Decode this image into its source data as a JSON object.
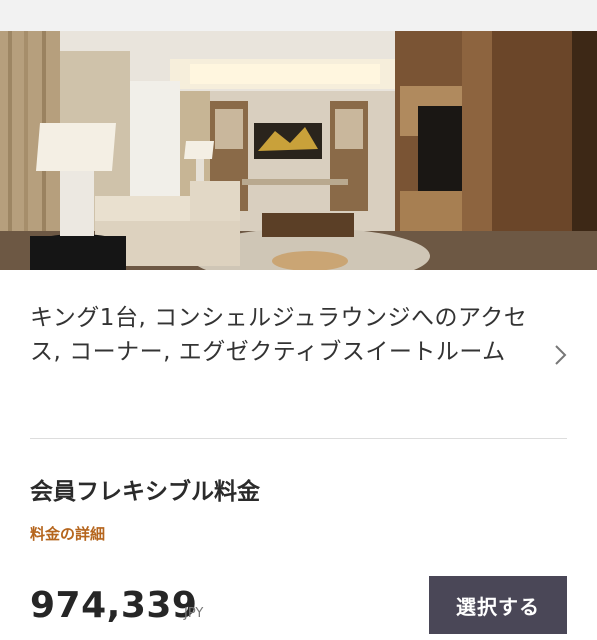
{
  "room": {
    "name": "キング1台, コンシェルジュラウンジへのアクセス, コーナー, エグゼクティブスイートルーム",
    "photo_icon": "suite-living-room-photo",
    "chevron_icon": "chevron-right-icon"
  },
  "rate": {
    "name": "会員フレキシブル料金",
    "details_link": "料金の詳細",
    "price": "974,339",
    "currency": "JPY",
    "select_label": "選択する"
  },
  "colors": {
    "accent_link": "#b5651d",
    "button_bg": "#4a4757",
    "divider": "#dddddd"
  }
}
